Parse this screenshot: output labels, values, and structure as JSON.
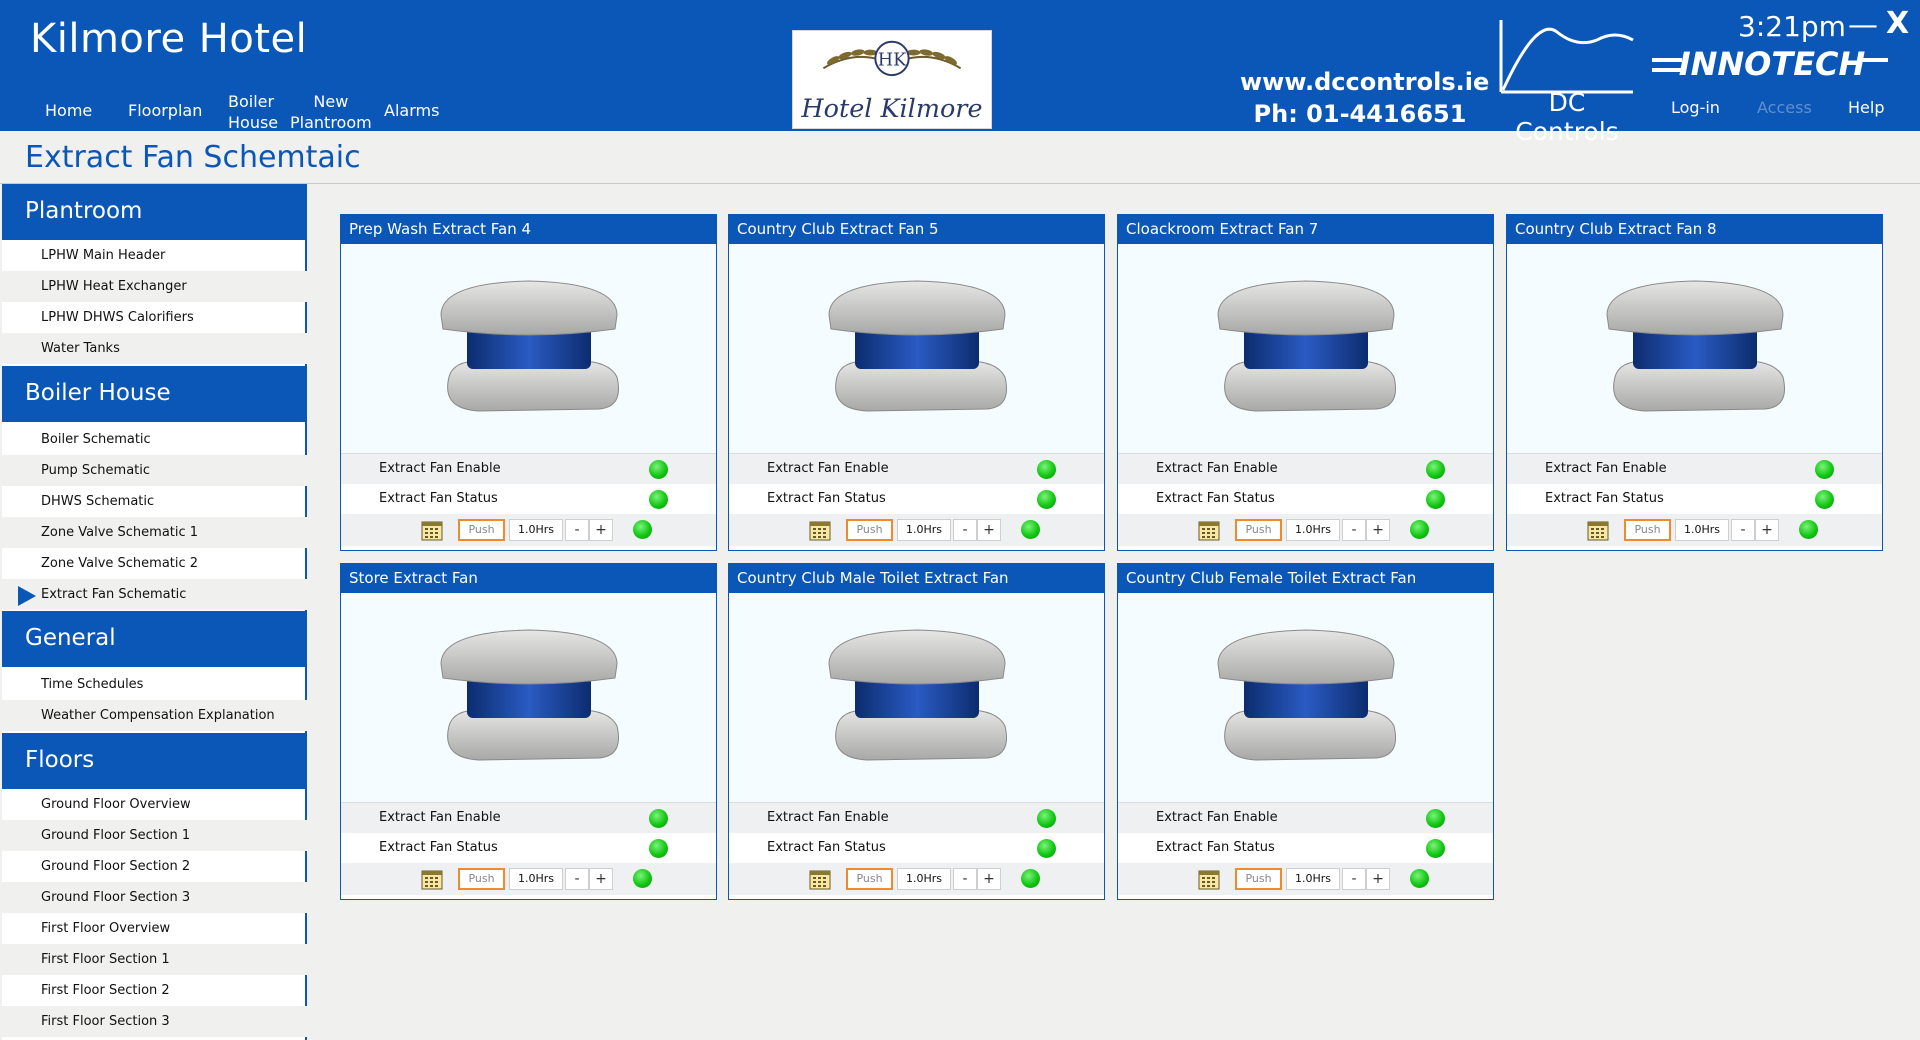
{
  "header": {
    "hotel_title": "Kilmore Hotel",
    "nav": [
      {
        "label": "Home"
      },
      {
        "label": "Floorplan"
      },
      {
        "label": "Boiler\nHouse"
      },
      {
        "label": "New\nPlantroom"
      },
      {
        "label": "Alarms"
      }
    ],
    "logo_monogram": "HK",
    "logo_text": "Hotel Kilmore",
    "website": "www.dccontrols.ie",
    "phone": "Ph: 01-4416651",
    "dc_brand": "DC Controls",
    "innotech_brand": "INNOTECH",
    "time": "3:21pm",
    "minimize_label": "—",
    "close_label": "X",
    "links": [
      {
        "label": "Log-in",
        "enabled": true
      },
      {
        "label": "Access",
        "enabled": false
      },
      {
        "label": "Help",
        "enabled": true
      }
    ]
  },
  "page_title": "Extract Fan Schemtaic",
  "sidebar": {
    "sections": [
      {
        "title": "Plantroom",
        "items": [
          "LPHW Main Header",
          "LPHW Heat Exchanger",
          "LPHW DHWS Calorifiers",
          "Water Tanks"
        ]
      },
      {
        "title": "Boiler House",
        "items": [
          "Boiler Schematic",
          "Pump Schematic",
          "DHWS Schematic",
          "Zone Valve Schematic 1",
          "Zone Valve Schematic 2",
          "Extract Fan Schematic"
        ]
      },
      {
        "title": "General",
        "items": [
          "Time Schedules",
          "Weather Compensation Explanation"
        ]
      },
      {
        "title": "Floors",
        "items": [
          "Ground Floor Overview",
          "Ground Floor Section 1",
          "Ground Floor Section 2",
          "Ground Floor Section 3",
          "First Floor Overview",
          "First Floor Section 1",
          "First Floor Section 2",
          "First Floor Section 3"
        ]
      }
    ],
    "active_item": "Extract Fan Schematic"
  },
  "panels": [
    {
      "title": "Prep Wash Extract Fan 4",
      "enable_label": "Extract Fan Enable",
      "status_label": "Extract Fan Status",
      "push_label": "Push",
      "hours": "1.0Hrs",
      "minus": "-",
      "plus": "+"
    },
    {
      "title": "Country Club Extract Fan 5",
      "enable_label": "Extract Fan Enable",
      "status_label": "Extract Fan Status",
      "push_label": "Push",
      "hours": "1.0Hrs",
      "minus": "-",
      "plus": "+"
    },
    {
      "title": "Cloackroom Extract Fan 7",
      "enable_label": "Extract Fan Enable",
      "status_label": "Extract Fan Status",
      "push_label": "Push",
      "hours": "1.0Hrs",
      "minus": "-",
      "plus": "+"
    },
    {
      "title": "Country Club Extract Fan 8",
      "enable_label": "Extract Fan Enable",
      "status_label": "Extract Fan Status",
      "push_label": "Push",
      "hours": "1.0Hrs",
      "minus": "-",
      "plus": "+"
    },
    {
      "title": "Store Extract Fan",
      "enable_label": "Extract Fan Enable",
      "status_label": "Extract Fan Status",
      "push_label": "Push",
      "hours": "1.0Hrs",
      "minus": "-",
      "plus": "+"
    },
    {
      "title": "Country Club Male Toilet Extract Fan",
      "enable_label": "Extract Fan Enable",
      "status_label": "Extract Fan Status",
      "push_label": "Push",
      "hours": "1.0Hrs",
      "minus": "-",
      "plus": "+"
    },
    {
      "title": "Country Club Female Toilet Extract Fan",
      "enable_label": "Extract Fan Enable",
      "status_label": "Extract Fan Status",
      "push_label": "Push",
      "hours": "1.0Hrs",
      "minus": "-",
      "plus": "+"
    }
  ],
  "colors": {
    "brand_blue": "#0a57b8",
    "status_green": "#12c712",
    "push_orange": "#f08a2a"
  },
  "icons": {
    "calendar": "calendar-icon",
    "fan": "roof-extract-fan-icon",
    "active_marker": "triangle-right-icon"
  }
}
